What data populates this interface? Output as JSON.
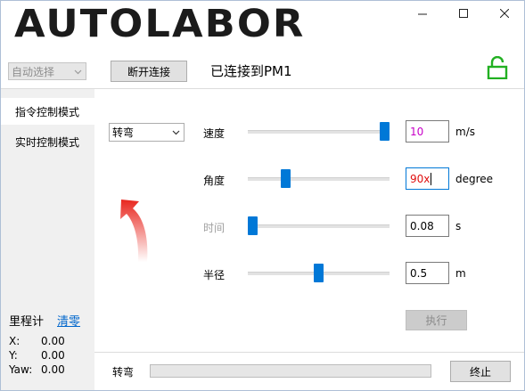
{
  "logo": "AUTOLABOR",
  "window_controls": {
    "minimize": "—",
    "maximize": "☐",
    "close": "✕"
  },
  "top_bar": {
    "port_select": "自动选择",
    "disconnect_button": "断开连接",
    "status": "已连接到PM1",
    "lock_icon": "unlock-icon",
    "lock_color": "#22b022"
  },
  "sidebar": {
    "modes": [
      "指令控制模式",
      "实时控制模式"
    ],
    "active_mode": "指令控制模式",
    "odometer": {
      "title": "里程计",
      "clear_link": "清零",
      "rows": [
        {
          "label": "X:",
          "value": "0.00"
        },
        {
          "label": "Y:",
          "value": "0.00"
        },
        {
          "label": "Yaw:",
          "value": "0.00"
        }
      ]
    }
  },
  "command": {
    "select": "转弯",
    "params": [
      {
        "label": "速度",
        "value": "10",
        "unit": "m/s",
        "enabled": true,
        "level": 1.0,
        "value_color": "#c800c8"
      },
      {
        "label": "角度",
        "value": "90x",
        "unit": "degree",
        "enabled": true,
        "level": 0.25,
        "value_color": "#e01010"
      },
      {
        "label": "时间",
        "value": "0.08",
        "unit": "s",
        "enabled": false,
        "level": 0.0,
        "value_color": "#000000"
      },
      {
        "label": "半径",
        "value": "0.5",
        "unit": "m",
        "enabled": true,
        "level": 0.5,
        "value_color": "#000000"
      }
    ],
    "execute_button": "执行"
  },
  "footer": {
    "status_label": "转弯",
    "progress": 0.0,
    "stop_button": "终止"
  },
  "colors": {
    "accent": "#0078d7",
    "link": "#0066cc",
    "arrow": "#e8261e"
  }
}
